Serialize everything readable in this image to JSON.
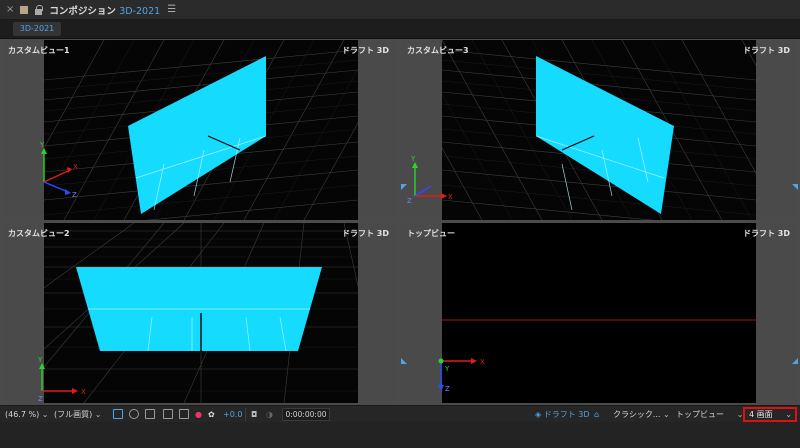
{
  "window": {
    "close_glyph": "×",
    "title": "コンポジション",
    "comp_name": "3D-2021",
    "menu_glyph": "☰"
  },
  "tab": {
    "label": "3D-2021"
  },
  "viewports": {
    "top_left": {
      "label": "カスタムビュー1",
      "mode": "ドラフト 3D"
    },
    "top_right": {
      "label": "カスタムビュー3",
      "mode": "ドラフト 3D"
    },
    "bottom_left": {
      "label": "カスタムビュー2",
      "mode": "ドラフト 3D"
    },
    "bottom_right": {
      "label": "トップビュー",
      "mode": "ドラフト 3D"
    }
  },
  "axes": {
    "x": "X",
    "y": "Y",
    "z": "Z"
  },
  "toolbar": {
    "zoom": "(46.7 %)",
    "resolution": "(フル画質)",
    "exposure": "+0.0",
    "timecode": "0:00:00:00",
    "draft3d": "ドラフト 3D",
    "renderer": "クラシック...",
    "view": "トップビュー",
    "layout": "4 画面"
  },
  "colors": {
    "accent": "#4fa3e6",
    "layer_fill": "#15dcff",
    "highlight_box": "#e01010",
    "axis_x": "#e01c1c",
    "axis_y": "#2bd32b",
    "axis_z": "#2c4bff"
  }
}
